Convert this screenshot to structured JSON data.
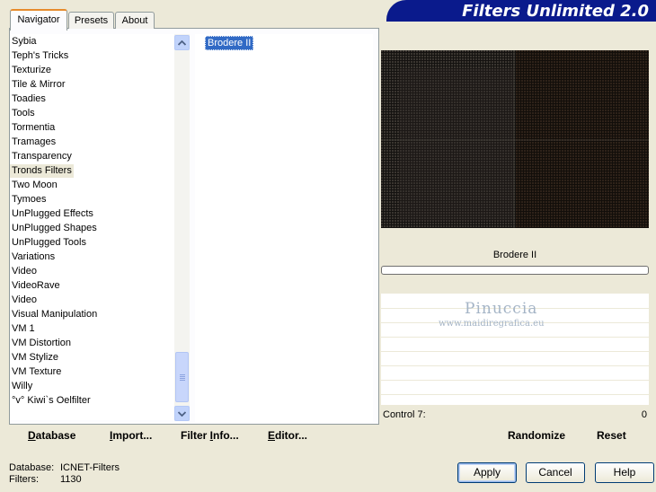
{
  "app": {
    "title": "Filters Unlimited 2.0"
  },
  "tabs": [
    {
      "label": "Navigator",
      "active": true
    },
    {
      "label": "Presets",
      "active": false
    },
    {
      "label": "About",
      "active": false
    }
  ],
  "categories": [
    "Sybia",
    "Teph's Tricks",
    "Texturize",
    "Tile & Mirror",
    "Toadies",
    "Tools",
    "Tormentia",
    "Tramages",
    "Transparency",
    "Tronds Filters",
    "Two Moon",
    "Tymoes",
    "UnPlugged Effects",
    "UnPlugged Shapes",
    "UnPlugged Tools",
    "Variations",
    "Video",
    "VideoRave",
    "Video",
    "Visual Manipulation",
    "VM 1",
    "VM Distortion",
    "VM Stylize",
    "VM Texture",
    "Willy",
    "°v° Kiwi`s Oelfilter"
  ],
  "selected_category": "Tronds Filters",
  "filters": [
    "Brodere II"
  ],
  "selected_filter": "Brodere II",
  "preview": {
    "filter_name": "Brodere II"
  },
  "controls": {
    "label": "Control 7:",
    "value": "0"
  },
  "watermark": {
    "name": "Pinuccia",
    "url": "www.maidiregrafica.eu"
  },
  "toolbar_left": {
    "database": {
      "label": "Database",
      "accel": "D",
      "rest": "atabase"
    },
    "import": {
      "accel": "I",
      "rest": "mport..."
    },
    "filter_info": {
      "pre": "Filter ",
      "accel": "I",
      "rest": "nfo..."
    },
    "editor": {
      "accel": "E",
      "rest": "ditor..."
    }
  },
  "toolbar_right": {
    "randomize": "Randomize",
    "reset": "Reset"
  },
  "status": {
    "database_label": "Database:",
    "database_value": "ICNET-Filters",
    "filters_label": "Filters:",
    "filters_value": "1130"
  },
  "buttons": {
    "apply": "Apply",
    "cancel": "Cancel",
    "help": "Help"
  },
  "colors": {
    "banner": "#0a1a8c",
    "selection": "#316ac5",
    "active_tab_accent": "#e68b2c"
  }
}
